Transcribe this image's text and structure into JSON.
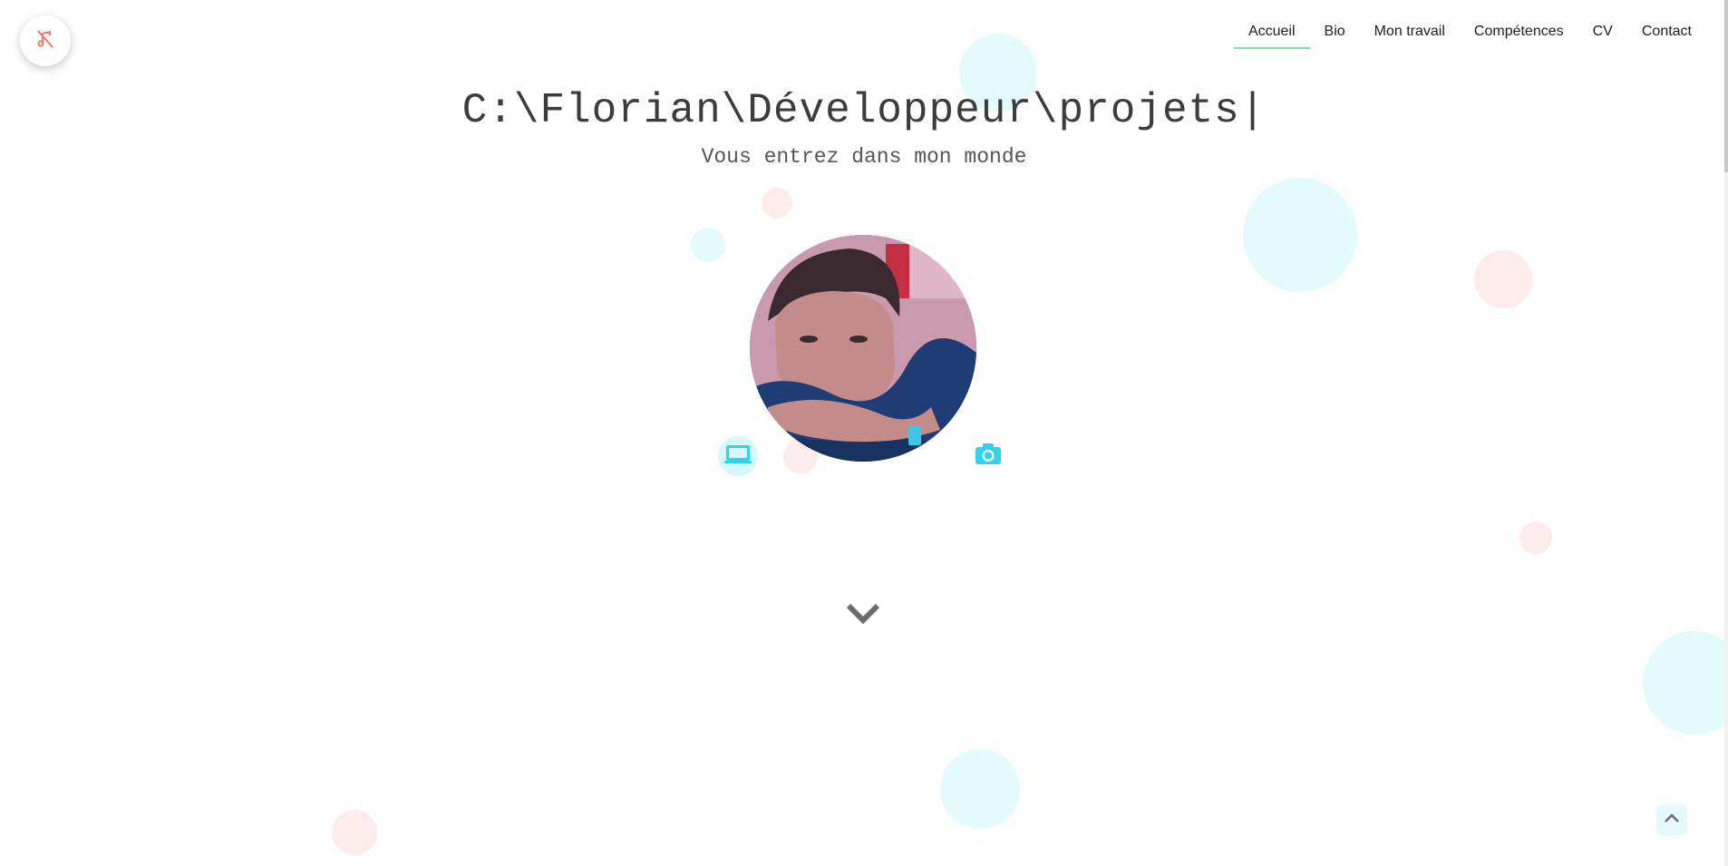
{
  "nav": {
    "items": [
      {
        "label": "Accueil",
        "active": true
      },
      {
        "label": "Bio",
        "active": false
      },
      {
        "label": "Mon travail",
        "active": false
      },
      {
        "label": "Compétences",
        "active": false
      },
      {
        "label": "CV",
        "active": false
      },
      {
        "label": "Contact",
        "active": false
      }
    ],
    "active_underline_color": "#7ee3a8"
  },
  "hero": {
    "title": "C:\\Florian\\Développeur\\projets|",
    "subtitle": "Vous entrez dans mon monde"
  },
  "icons": {
    "sound_toggle": "music-off-icon",
    "laptop": "laptop-icon",
    "camera": "camera-icon",
    "scroll_down": "chevron-down-icon",
    "back_to_top": "chevron-up-icon"
  },
  "colors": {
    "accent_cyan": "#2fd3ea",
    "sound_icon": "#ef6b5e",
    "bubble_cyan": "#e3fbfd",
    "bubble_pink": "#fdeceb"
  }
}
